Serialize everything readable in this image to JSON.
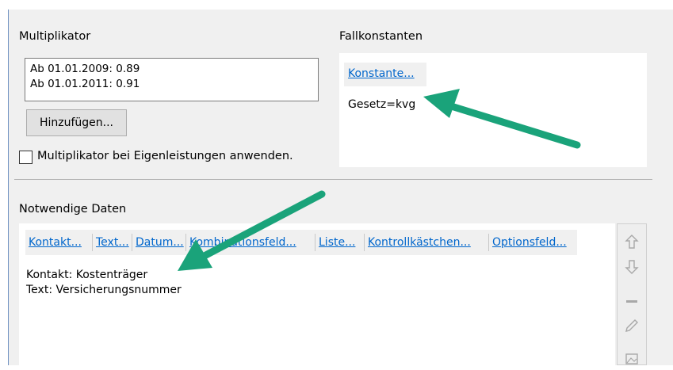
{
  "multiplikator": {
    "title": "Multiplikator",
    "entries": [
      "Ab 01.01.2009: 0.89",
      "Ab 01.01.2011: 0.91"
    ],
    "add_button": "Hinzufügen...",
    "checkbox_label": "Multiplikator bei Eigenleistungen anwenden.",
    "checkbox_checked": false
  },
  "fallkonstanten": {
    "title": "Fallkonstanten",
    "link": "Konstante...",
    "value": "Gesetz=kvg"
  },
  "notwendige": {
    "title": "Notwendige Daten",
    "links": [
      "Kontakt...",
      "Text...",
      "Datum...",
      "Kombinationsfeld...",
      "Liste...",
      "Kontrollkästchen...",
      "Optionsfeld..."
    ],
    "items": [
      "Kontakt:  Kostenträger",
      "Text: Versicherungsnummer"
    ]
  },
  "toolbar": {
    "icons": [
      "arrow-up-icon",
      "arrow-down-icon",
      "minus-icon",
      "pencil-icon",
      "image-icon"
    ]
  },
  "colors": {
    "annotation_arrow": "#1aa37a",
    "link": "#0066cc",
    "panel": "#f0f0f0"
  }
}
